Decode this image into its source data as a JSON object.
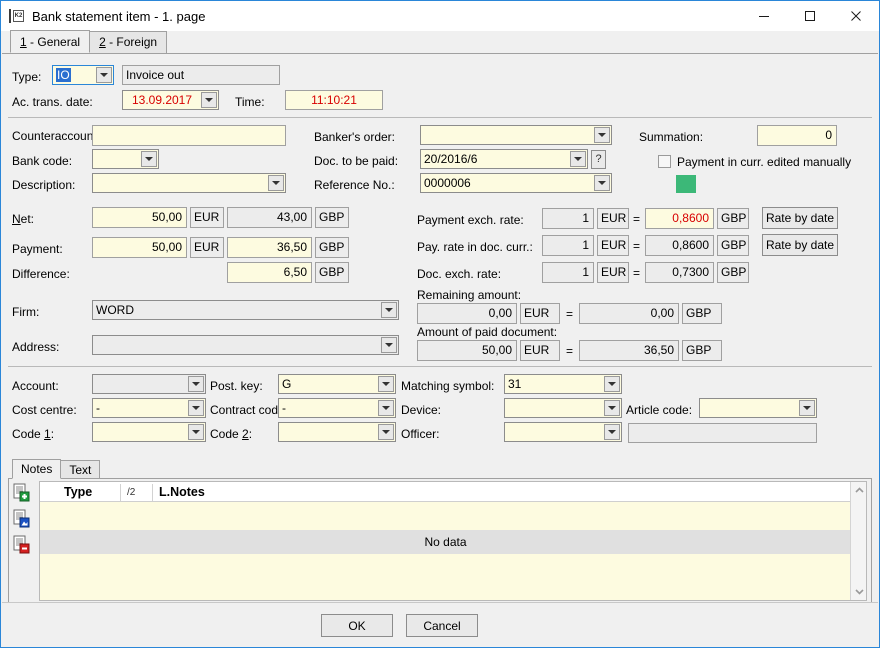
{
  "window": {
    "title": "Bank statement item - 1. page",
    "icon": "app-icon",
    "minimize": "minimize-icon",
    "maximize": "maximize-icon",
    "close": "close-icon"
  },
  "tabs": [
    {
      "key": "1",
      "label": "General",
      "active": true
    },
    {
      "key": "2",
      "label": "Foreign",
      "active": false
    }
  ],
  "general": {
    "type_label": "Type:",
    "type_value": "IO",
    "type_desc": "Invoice out",
    "date_label": "Ac. trans. date:",
    "date_value": "13.09.2017",
    "time_label": "Time:",
    "time_value": "11:10:21",
    "counteraccount_label": "Counteraccount:",
    "counteraccount_value": "",
    "bankcode_label": "Bank code:",
    "bankcode_value": "",
    "description_label": "Description:",
    "description_value": "",
    "net_label": "Net:",
    "net_amount": "50,00",
    "net_currency": "EUR",
    "net_amount2": "43,00",
    "net_currency2": "GBP",
    "payment_label": "Payment:",
    "payment_amount": "50,00",
    "payment_currency": "EUR",
    "payment_amount2": "36,50",
    "payment_currency2": "GBP",
    "difference_label": "Difference:",
    "difference_amount2": "6,50",
    "difference_currency2": "GBP",
    "bankers_order_label": "Banker's order:",
    "bankers_order_value": "",
    "doc_to_be_paid_label": "Doc. to be paid:",
    "doc_to_be_paid_value": "20/2016/6",
    "doc_help_button": "?",
    "reference_no_label": "Reference No.:",
    "reference_no_value": "0000006",
    "summation_label": "Summation:",
    "summation_value": "0",
    "payment_manual_label": "Payment in curr. edited manually",
    "payment_manual_checked": false,
    "payment_exch_rate_label": "Payment exch. rate:",
    "payment_exch_rate_base": "1",
    "payment_exch_rate_base_cur": "EUR",
    "payment_exch_rate_eq": "=",
    "payment_exch_rate_value": "0,8600",
    "payment_exch_rate_cur": "GBP",
    "rate_by_date_1": "Rate by date",
    "pay_rate_doc_label": "Pay. rate in doc. curr.:",
    "pay_rate_doc_base": "1",
    "pay_rate_doc_base_cur": "EUR",
    "pay_rate_doc_eq": "=",
    "pay_rate_doc_value": "0,8600",
    "pay_rate_doc_cur": "GBP",
    "rate_by_date_2": "Rate by date",
    "doc_exch_rate_label": "Doc. exch. rate:",
    "doc_exch_rate_base": "1",
    "doc_exch_rate_base_cur": "EUR",
    "doc_exch_rate_eq": "=",
    "doc_exch_rate_value": "0,7300",
    "doc_exch_rate_cur": "GBP",
    "firm_label": "Firm:",
    "firm_value": "WORD",
    "address_label": "Address:",
    "address_value": "",
    "remaining_amount_label": "Remaining amount:",
    "remaining_amount": "0,00",
    "remaining_currency": "EUR",
    "remaining_eq": "=",
    "remaining_amount2": "0,00",
    "remaining_currency2": "GBP",
    "amount_paid_label": "Amount of paid document:",
    "amount_paid": "50,00",
    "amount_paid_currency": "EUR",
    "amount_paid_eq": "=",
    "amount_paid2": "36,50",
    "amount_paid_currency2": "GBP",
    "account_label": "Account:",
    "account_value": "",
    "post_key_label": "Post. key:",
    "post_key_value": "G",
    "matching_symbol_label": "Matching symbol:",
    "matching_symbol_value": "31",
    "cost_centre_label": "Cost centre:",
    "cost_centre_value": "-",
    "contract_code_label": "Contract code:",
    "contract_code_value": "-",
    "device_label": "Device:",
    "device_value": "",
    "article_code_label": "Article code:",
    "article_code_value": "",
    "code1_label": "Code 1:",
    "code1_value": "",
    "code2_label": "Code 2:",
    "code2_value": "",
    "officer_label": "Officer:",
    "officer_value": "",
    "officer_desc": ""
  },
  "notes": {
    "tabs": [
      {
        "label": "Notes",
        "active": true
      },
      {
        "label": "Text",
        "active": false
      }
    ],
    "tools": [
      {
        "name": "add-note-icon"
      },
      {
        "name": "view-note-icon"
      },
      {
        "name": "delete-note-icon"
      }
    ],
    "columns": [
      "Type",
      "L.Notes"
    ],
    "sort_indicator": "/2",
    "rows": [],
    "empty_text": "No data",
    "scroll_up": "scroll-up-icon",
    "scroll_down": "scroll-down-icon"
  },
  "footer": {
    "ok_label": "OK",
    "cancel_label": "Cancel"
  },
  "colors": {
    "window_border": "#2a86d8",
    "field_bg": "#fdfbe0",
    "readonly_bg": "#ececec",
    "accent_red": "#d80000",
    "green_flag": "#3cb878",
    "selection_blue": "#2a6fd0"
  }
}
